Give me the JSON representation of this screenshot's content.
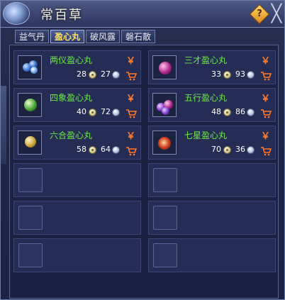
{
  "window": {
    "title": "常百草"
  },
  "icons": {
    "help": "?",
    "close": "╳",
    "currency": "￥",
    "cart": "cart-icon",
    "coin_gold": "coin-icon",
    "coin_silver": "silver-coin-icon"
  },
  "tabs": [
    {
      "label": "益气丹",
      "active": false
    },
    {
      "label": "盈心丸",
      "active": true
    },
    {
      "label": "破风露",
      "active": false
    },
    {
      "label": "磐石散",
      "active": false
    }
  ],
  "items": [
    {
      "name": "两仪盈心丸",
      "price_a": "28",
      "price_b": "27",
      "orb_color": "#3a76d6"
    },
    {
      "name": "三才盈心丸",
      "price_a": "33",
      "price_b": "93",
      "orb_color": "#b0268a"
    },
    {
      "name": "四象盈心丸",
      "price_a": "40",
      "price_b": "72",
      "orb_color": "#49a634"
    },
    {
      "name": "五行盈心丸",
      "price_a": "48",
      "price_b": "86",
      "orb_color": "#8c3bd0"
    },
    {
      "name": "六合盈心丸",
      "price_a": "58",
      "price_b": "64",
      "orb_color": "#d0a63a"
    },
    {
      "name": "七星盈心丸",
      "price_a": "70",
      "price_b": "36",
      "orb_color": "#d04023"
    }
  ],
  "empty_slots": 6,
  "colors": {
    "item_name": "#6ee84b",
    "currency_accent": "#ff7a2a",
    "active_tab_text": "#ffe45a"
  }
}
